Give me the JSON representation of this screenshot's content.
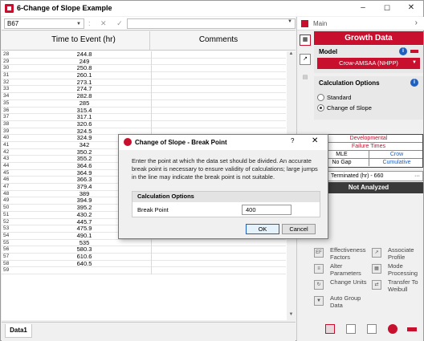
{
  "window": {
    "title": "6-Change of Slope Example",
    "min": "–",
    "max": "☐",
    "close": "✕"
  },
  "formula": {
    "cell": "B67",
    "fx_cancel": "✕",
    "fx_ok": "✓"
  },
  "grid": {
    "col1": "Time to Event (hr)",
    "col2": "Comments",
    "rows": [
      {
        "n": "28",
        "v": "244.8"
      },
      {
        "n": "29",
        "v": "249"
      },
      {
        "n": "30",
        "v": "250.8"
      },
      {
        "n": "31",
        "v": "260.1"
      },
      {
        "n": "32",
        "v": "273.1"
      },
      {
        "n": "33",
        "v": "274.7"
      },
      {
        "n": "34",
        "v": "282.8"
      },
      {
        "n": "35",
        "v": "285"
      },
      {
        "n": "36",
        "v": "315.4"
      },
      {
        "n": "37",
        "v": "317.1"
      },
      {
        "n": "38",
        "v": "320.6"
      },
      {
        "n": "39",
        "v": "324.5"
      },
      {
        "n": "40",
        "v": "324.9"
      },
      {
        "n": "41",
        "v": "342"
      },
      {
        "n": "42",
        "v": "350.2"
      },
      {
        "n": "43",
        "v": "355.2"
      },
      {
        "n": "44",
        "v": "364.6"
      },
      {
        "n": "45",
        "v": "364.9"
      },
      {
        "n": "46",
        "v": "366.3"
      },
      {
        "n": "47",
        "v": "379.4"
      },
      {
        "n": "48",
        "v": "389"
      },
      {
        "n": "49",
        "v": "394.9"
      },
      {
        "n": "50",
        "v": "395.2"
      },
      {
        "n": "51",
        "v": "430.2"
      },
      {
        "n": "52",
        "v": "445.7"
      },
      {
        "n": "53",
        "v": "475.9"
      },
      {
        "n": "54",
        "v": "490.1"
      },
      {
        "n": "55",
        "v": "535"
      },
      {
        "n": "56",
        "v": "580.3"
      },
      {
        "n": "57",
        "v": "610.6"
      },
      {
        "n": "58",
        "v": "640.5"
      },
      {
        "n": "59",
        "v": ""
      }
    ]
  },
  "sheet_tab": "Data1",
  "panel": {
    "main": "Main",
    "growth": "Growth Data",
    "model_label": "Model",
    "model_value": "Crow-AMSAA (NHPP)",
    "calc_label": "Calculation Options",
    "opt1": "Standard",
    "opt2": "Change of Slope",
    "t_dev": "Developmental",
    "t_fail": "Failure Times",
    "t_mle": "MLE",
    "t_crow": "Crow",
    "t_nogap": "No Gap",
    "t_cum": "Cumulative",
    "term": "Terminated (hr) - 660",
    "term_more": "···",
    "status": "Not Analyzed",
    "acts": [
      "Effectiveness Factors",
      "Associate Profile",
      "Alter Parameters",
      "Mode Processing",
      "Change Units",
      "Transfer To Weibull",
      "Auto Group Data"
    ]
  },
  "dialog": {
    "title": "Change of Slope - Break Point",
    "help": "?",
    "close": "✕",
    "desc": "Enter the point at which the data set should be divided. An accurate break point is necessary to ensure validity of calculations; large jumps in the line may indicate the break point is not suitable.",
    "group": "Calculation Options",
    "field_label": "Break Point",
    "field_value": "400",
    "ok": "OK",
    "cancel": "Cancel"
  }
}
